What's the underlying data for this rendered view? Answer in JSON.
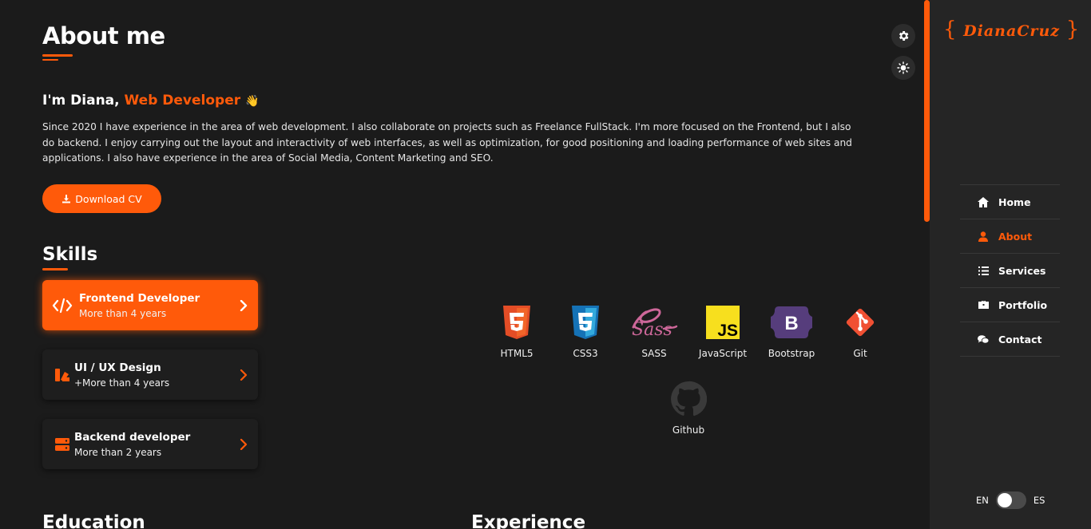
{
  "header": {
    "title": "About me"
  },
  "intro": {
    "greeting": "I'm Diana, ",
    "role": "Web Developer",
    "emoji": "👋"
  },
  "bio": "Since 2020 I have experience in the area of web development. I also collaborate on projects such as Freelance FullStack. I'm more focused on the Frontend, but I also do backend. I enjoy carrying out the layout and interactivity of web interfaces, as well as optimization, for good positioning and loading performance of web sites and applications. I also have experience in the area of Social Media, Content Marketing and SEO.",
  "cv_button": {
    "label": "Download CV",
    "icon": "download-icon"
  },
  "skills": {
    "title": "Skills",
    "cards": [
      {
        "title": "Frontend Developer",
        "subtitle": "More than 4 years",
        "icon": "code-icon",
        "active": true
      },
      {
        "title": "UI / UX Design",
        "subtitle": "+More than 4 years",
        "icon": "palette-icon",
        "active": false
      },
      {
        "title": "Backend developer",
        "subtitle": "More than 2 years",
        "icon": "server-icon",
        "active": false
      }
    ],
    "technologies": [
      {
        "label": "HTML5",
        "icon": "html5-icon"
      },
      {
        "label": "CSS3",
        "icon": "css3-icon"
      },
      {
        "label": "SASS",
        "icon": "sass-icon"
      },
      {
        "label": "JavaScript",
        "icon": "javascript-icon"
      },
      {
        "label": "Bootstrap",
        "icon": "bootstrap-icon"
      },
      {
        "label": "Git",
        "icon": "git-icon"
      },
      {
        "label": "Github",
        "icon": "github-icon"
      }
    ]
  },
  "sections": {
    "education": "Education",
    "experience": "Experience"
  },
  "sidebar": {
    "brand": {
      "open": "{",
      "first": "Diana",
      "last": "Cruz",
      "close": "}"
    },
    "nav": [
      {
        "label": "Home",
        "icon": "home-icon",
        "active": false
      },
      {
        "label": "About",
        "icon": "user-icon",
        "active": true
      },
      {
        "label": "Services",
        "icon": "list-icon",
        "active": false
      },
      {
        "label": "Portfolio",
        "icon": "briefcase-icon",
        "active": false
      },
      {
        "label": "Contact",
        "icon": "chat-icon",
        "active": false
      }
    ],
    "lang": {
      "left": "EN",
      "right": "ES"
    }
  },
  "colors": {
    "accent": "#ff5a0a",
    "background": "#1b1b1b",
    "sidebar": "#252525"
  }
}
